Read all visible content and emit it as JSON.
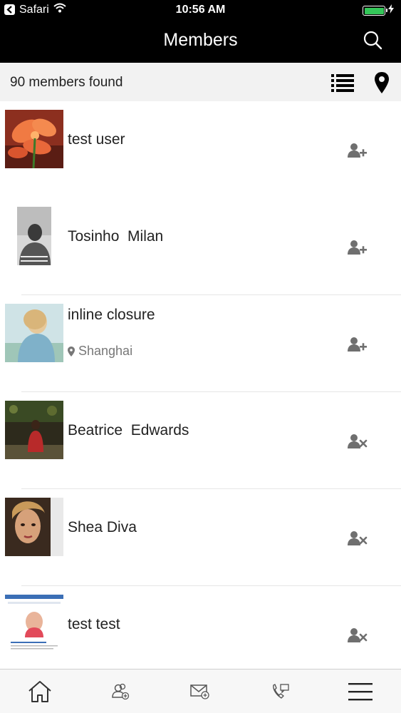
{
  "status_bar": {
    "carrier": "Safari",
    "time": "10:56 AM"
  },
  "nav": {
    "title": "Members"
  },
  "sub_header": {
    "count_text": "90 members found"
  },
  "members": [
    {
      "name": "test user",
      "location": "",
      "action": "add-friend"
    },
    {
      "name": "Tosinho  Milan",
      "location": "",
      "action": "add-friend"
    },
    {
      "name": "inline closure",
      "location": "Shanghai",
      "action": "add-friend"
    },
    {
      "name": "Beatrice  Edwards",
      "location": "",
      "action": "remove-friend"
    },
    {
      "name": "Shea Diva",
      "location": "",
      "action": "remove-friend"
    },
    {
      "name": "test test",
      "location": "",
      "action": "remove-friend"
    }
  ],
  "tabs": [
    {
      "icon": "home-icon"
    },
    {
      "icon": "members-icon"
    },
    {
      "icon": "mail-icon"
    },
    {
      "icon": "call-icon"
    },
    {
      "icon": "menu-icon"
    }
  ],
  "colors": {
    "header_bg": "#000000",
    "subheader_bg": "#f2f2f2",
    "icon_gray": "#6f6f6f",
    "battery_green": "#34c759"
  }
}
